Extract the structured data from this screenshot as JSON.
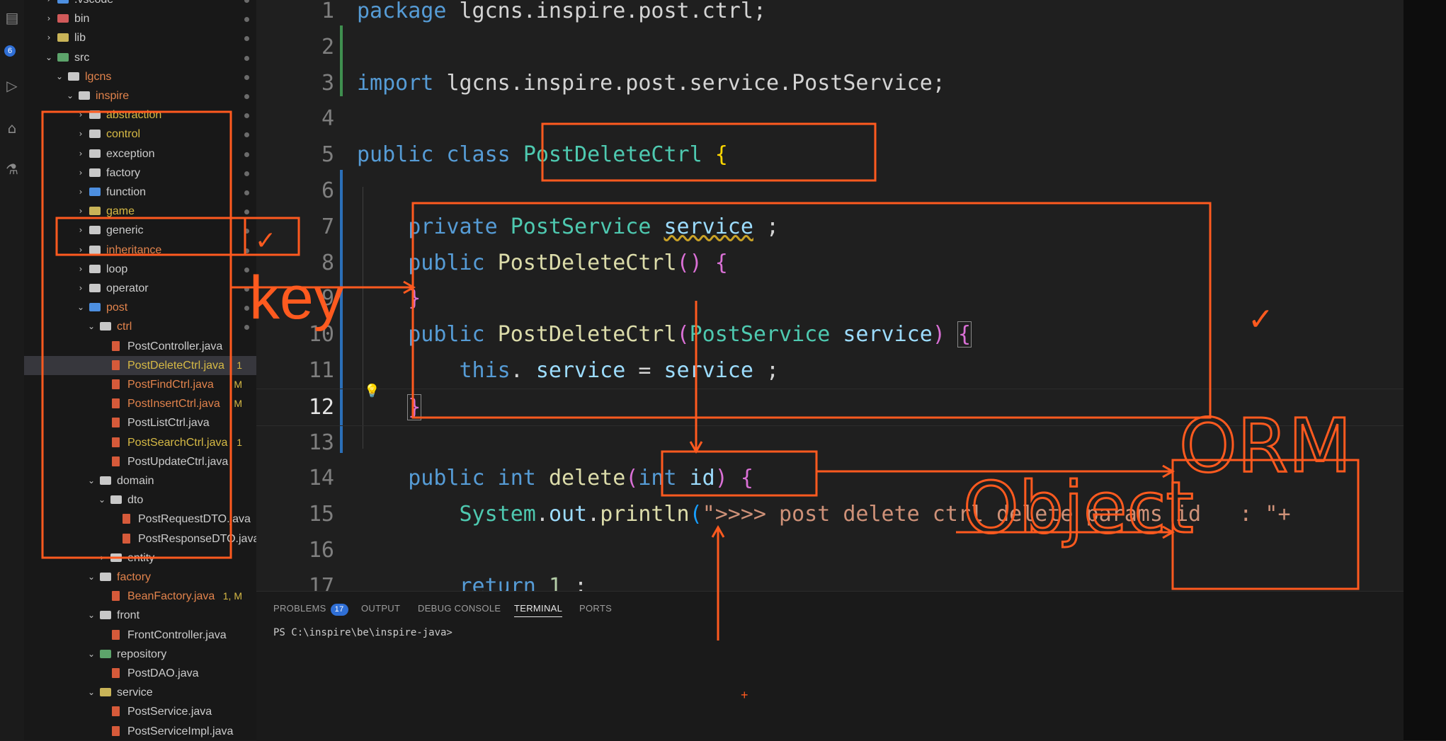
{
  "activity_bar": {
    "icons": [
      "files-icon",
      "search-icon",
      "source-control-icon",
      "run-debug-icon",
      "extensions-icon",
      "testing-icon"
    ],
    "scm_badge": "6"
  },
  "explorer": {
    "rows": [
      {
        "label": ".vscode",
        "icon": "folder",
        "color": "blue",
        "open": false
      },
      {
        "label": "bin",
        "icon": "folder",
        "color": "red",
        "open": false
      },
      {
        "label": "lib",
        "icon": "folder",
        "color": "yellow",
        "open": false
      },
      {
        "label": "src",
        "icon": "folder",
        "color": "green",
        "open": true
      },
      {
        "label": "lgcns",
        "icon": "folder",
        "color": "grey",
        "open": true,
        "label_color": "orange"
      },
      {
        "label": "inspire",
        "icon": "folder",
        "color": "grey",
        "open": true,
        "label_color": "orange"
      },
      {
        "label": "abstraction",
        "icon": "folder",
        "color": "grey",
        "open": false,
        "label_color": "yellow"
      },
      {
        "label": "control",
        "icon": "folder",
        "color": "grey",
        "open": false,
        "label_color": "yellow"
      },
      {
        "label": "exception",
        "icon": "folder",
        "color": "grey",
        "open": false
      },
      {
        "label": "factory",
        "icon": "folder",
        "color": "grey",
        "open": false
      },
      {
        "label": "function",
        "icon": "folder",
        "color": "blue",
        "open": false
      },
      {
        "label": "game",
        "icon": "folder",
        "color": "yellow",
        "open": false,
        "label_color": "yellow"
      },
      {
        "label": "generic",
        "icon": "folder",
        "color": "grey",
        "open": false
      },
      {
        "label": "inheritance",
        "icon": "folder",
        "color": "grey",
        "open": false,
        "label_color": "orange"
      },
      {
        "label": "loop",
        "icon": "folder",
        "color": "grey",
        "open": false
      },
      {
        "label": "operator",
        "icon": "folder",
        "color": "grey",
        "open": false
      },
      {
        "label": "post",
        "icon": "folder",
        "color": "blue",
        "open": true,
        "label_color": "orange"
      },
      {
        "label": "ctrl",
        "icon": "folder",
        "color": "grey",
        "open": true,
        "label_color": "orange"
      },
      {
        "label": "PostController.java",
        "icon": "java"
      },
      {
        "label": "PostDeleteCtrl.java",
        "icon": "java",
        "label_color": "yellow",
        "status": "1",
        "selected": true
      },
      {
        "label": "PostFindCtrl.java",
        "icon": "java",
        "label_color": "orange",
        "status": "M"
      },
      {
        "label": "PostInsertCtrl.java",
        "icon": "java",
        "label_color": "orange",
        "status": "M"
      },
      {
        "label": "PostListCtrl.java",
        "icon": "java"
      },
      {
        "label": "PostSearchCtrl.java",
        "icon": "java",
        "label_color": "yellow",
        "status": "1"
      },
      {
        "label": "PostUpdateCtrl.java",
        "icon": "java"
      },
      {
        "label": "domain",
        "icon": "folder",
        "color": "grey",
        "open": true
      },
      {
        "label": "dto",
        "icon": "folder",
        "color": "grey",
        "open": true
      },
      {
        "label": "PostRequestDTO.java",
        "icon": "java"
      },
      {
        "label": "PostResponseDTO.java",
        "icon": "java"
      },
      {
        "label": "entity",
        "icon": "folder",
        "color": "grey",
        "open": false
      },
      {
        "label": "factory",
        "icon": "folder",
        "color": "grey",
        "open": true,
        "label_color": "orange"
      },
      {
        "label": "BeanFactory.java",
        "icon": "java",
        "label_color": "orange",
        "status": "1, M"
      },
      {
        "label": "front",
        "icon": "folder",
        "color": "grey",
        "open": true
      },
      {
        "label": "FrontController.java",
        "icon": "java"
      },
      {
        "label": "repository",
        "icon": "folder",
        "color": "green",
        "open": true
      },
      {
        "label": "PostDAO.java",
        "icon": "java"
      },
      {
        "label": "service",
        "icon": "folder",
        "color": "yellow",
        "open": true
      },
      {
        "label": "PostService.java",
        "icon": "java"
      },
      {
        "label": "PostServiceImpl.java",
        "icon": "java"
      }
    ]
  },
  "editor": {
    "active_line": "12",
    "lines": [
      {
        "n": "1",
        "tokens": [
          [
            "kw",
            "package "
          ],
          [
            "",
            "lgcns.inspire.post.ctrl;"
          ]
        ]
      },
      {
        "n": "2",
        "tokens": []
      },
      {
        "n": "3",
        "tokens": [
          [
            "kw",
            "import "
          ],
          [
            "",
            "lgcns.inspire.post.service.PostService;"
          ]
        ]
      },
      {
        "n": "4",
        "tokens": []
      },
      {
        "n": "5",
        "tokens": [
          [
            "kw",
            "public class "
          ],
          [
            "ty",
            "PostDeleteCtrl "
          ],
          [
            "br1",
            "{"
          ]
        ]
      },
      {
        "n": "6",
        "tokens": []
      },
      {
        "n": "7",
        "tokens": [
          [
            "",
            "    "
          ],
          [
            "kw",
            "private "
          ],
          [
            "ty",
            "PostService "
          ],
          [
            "va squig",
            "service"
          ],
          [
            "",
            " ;"
          ]
        ]
      },
      {
        "n": "8",
        "tokens": [
          [
            "",
            "    "
          ],
          [
            "kw",
            "public "
          ],
          [
            "fn",
            "PostDeleteCtrl"
          ],
          [
            "br2",
            "() {"
          ]
        ]
      },
      {
        "n": "9",
        "tokens": [
          [
            "",
            "    "
          ],
          [
            "br2",
            "}"
          ]
        ]
      },
      {
        "n": "10",
        "tokens": [
          [
            "",
            "    "
          ],
          [
            "kw",
            "public "
          ],
          [
            "fn",
            "PostDeleteCtrl"
          ],
          [
            "br2",
            "("
          ],
          [
            "ty",
            "PostService "
          ],
          [
            "va",
            "service"
          ],
          [
            "br2",
            ") "
          ],
          [
            "br2 box-bracket",
            "{"
          ]
        ]
      },
      {
        "n": "11",
        "tokens": [
          [
            "",
            "        "
          ],
          [
            "kw",
            "this"
          ],
          [
            "",
            ". "
          ],
          [
            "va",
            "service"
          ],
          [
            "",
            " = "
          ],
          [
            "va",
            "service"
          ],
          [
            "",
            " ;"
          ]
        ]
      },
      {
        "n": "12",
        "tokens": [
          [
            "",
            "    "
          ],
          [
            "br2 box-bracket",
            "}"
          ]
        ]
      },
      {
        "n": "13",
        "tokens": []
      },
      {
        "n": "14",
        "tokens": [
          [
            "",
            "    "
          ],
          [
            "kw",
            "public int "
          ],
          [
            "fn",
            "delete"
          ],
          [
            "br2",
            "("
          ],
          [
            "kw",
            "int "
          ],
          [
            "va",
            "id"
          ],
          [
            "br2",
            ") {"
          ]
        ]
      },
      {
        "n": "15",
        "tokens": [
          [
            "",
            "        "
          ],
          [
            "ty",
            "System"
          ],
          [
            "",
            "."
          ],
          [
            "va",
            "out"
          ],
          [
            "",
            "."
          ],
          [
            "fn",
            "println"
          ],
          [
            "br3",
            "("
          ],
          [
            "st",
            "\">>>> post delete ctrl delete params id   : \"+"
          ]
        ]
      },
      {
        "n": "16",
        "tokens": []
      },
      {
        "n": "17",
        "tokens": [
          [
            "",
            "        "
          ],
          [
            "kw",
            "return "
          ],
          [
            "nu",
            "1"
          ],
          [
            "",
            " ;"
          ]
        ]
      }
    ]
  },
  "panel": {
    "tabs": [
      "PROBLEMS",
      "OUTPUT",
      "DEBUG CONSOLE",
      "TERMINAL",
      "PORTS"
    ],
    "problems_count": "17",
    "active_tab": "TERMINAL",
    "terminal_prompt": "PS C:\\inspire\\be\\inspire-java>"
  },
  "annotations": {
    "key_text": "key",
    "orm_text": "ORM",
    "object_text": "Object",
    "check": "✓",
    "color": "#ff5a1f"
  }
}
